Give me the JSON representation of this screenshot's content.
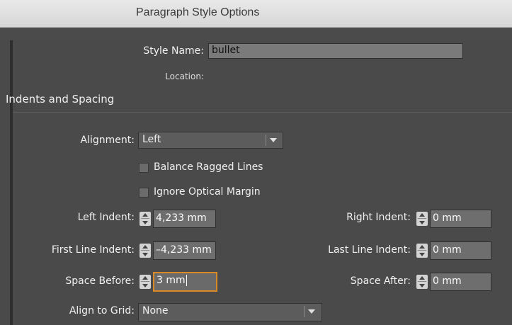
{
  "window": {
    "title": "Paragraph Style Options"
  },
  "style_name": {
    "label": "Style Name:",
    "value": "bullet"
  },
  "location": {
    "label": "Location:"
  },
  "section": {
    "title": "Indents and Spacing"
  },
  "alignment": {
    "label": "Alignment:",
    "value": "Left"
  },
  "balance_ragged": {
    "label": "Balance Ragged Lines",
    "checked": false
  },
  "ignore_optical": {
    "label": "Ignore Optical Margin",
    "checked": false
  },
  "left_indent": {
    "label": "Left Indent:",
    "value": "4,233 mm"
  },
  "right_indent": {
    "label": "Right Indent:",
    "value": "0 mm"
  },
  "first_line_indent": {
    "label": "First Line Indent:",
    "value": "–4,233 mm"
  },
  "last_line_indent": {
    "label": "Last Line Indent:",
    "value": "0 mm"
  },
  "space_before": {
    "label": "Space Before:",
    "value": "3 mm"
  },
  "space_after": {
    "label": "Space After:",
    "value": "0 mm"
  },
  "align_to_grid": {
    "label": "Align to Grid:",
    "value": "None"
  },
  "colors": {
    "focus": "#d98a27",
    "panel": "#4a4a4a",
    "titlebar": "#e0e0e0"
  }
}
